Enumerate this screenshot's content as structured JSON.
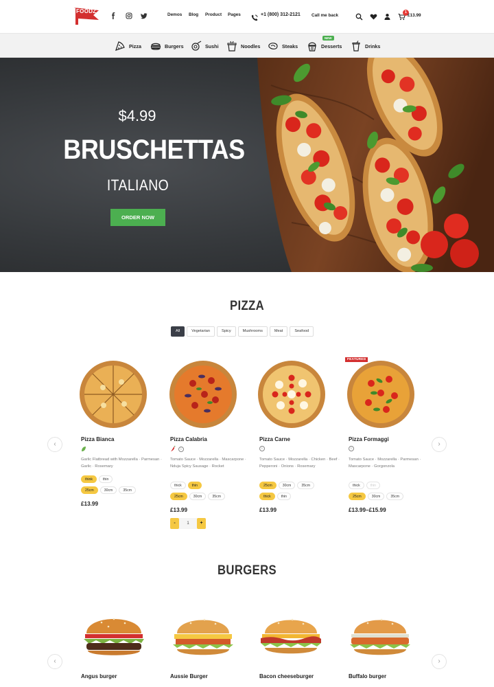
{
  "header": {
    "logo_text": "FOODZ",
    "nav": [
      "Demos",
      "Blog",
      "Product",
      "Pages"
    ],
    "phone": "+1 (800) 312-2121",
    "callback": "Call me back",
    "cart_count": "1",
    "cart_total": "£13.99"
  },
  "categories": [
    "Pizza",
    "Burgers",
    "Sushi",
    "Noodles",
    "Steaks",
    "Desserts",
    "Drinks"
  ],
  "new_badge": "NEW",
  "hero": {
    "price": "$4.99",
    "title": "BRUSCHETTAS",
    "subtitle": "ITALIANO",
    "button": "ORDER NOW"
  },
  "pizza": {
    "title": "PIZZA",
    "filters": [
      "All",
      "Vegetarian",
      "Spicy",
      "Mushrooms",
      "Meat",
      "Seafood"
    ],
    "featured_label": "FEATURED",
    "products": [
      {
        "name": "Pizza Bianca",
        "desc": "Garlic Flatbread with Mozzarella · Parmesan · Garlic · Rosemary",
        "opt1": [
          "think",
          "thin"
        ],
        "opt2": [
          "25cm",
          "30cm",
          "35cm"
        ],
        "price": "£13.99"
      },
      {
        "name": "Pizza Calabria",
        "desc": "Tomato Sauce · Mozzarella · Mascarpone · Nduja Spicy Sausage · Rocket",
        "opt1": [
          "thick",
          "thin"
        ],
        "opt2": [
          "25cm",
          "30cm",
          "35cm"
        ],
        "price": "£13.99"
      },
      {
        "name": "Pizza Carne",
        "desc": "Tomato Sauce · Mozzarella · Chicken · Beef · Pepperoni · Onions · Rosemary",
        "opt1": [
          "25cm",
          "30cm",
          "35cm"
        ],
        "opt2": [
          "thick",
          "thin"
        ],
        "price": "£13.99"
      },
      {
        "name": "Pizza Formaggi",
        "desc": "Tomato Sauce · Mozzarella · Parmesan · Mascarpone · Gorgonzola",
        "opt1": [
          "thick",
          "thin"
        ],
        "opt2": [
          "25cm",
          "30cm",
          "35cm"
        ],
        "price": "£13.99–£15.99"
      }
    ],
    "qty": {
      "minus": "-",
      "value": "1",
      "plus": "+"
    }
  },
  "burgers": {
    "title": "BURGERS",
    "products": [
      "Angus burger",
      "Aussie Burger",
      "Bacon cheeseburger",
      "Buffalo burger"
    ]
  },
  "colors": {
    "accent_green": "#4caf50",
    "chip_yellow": "#f5c842",
    "badge_red": "#d32f2f"
  }
}
